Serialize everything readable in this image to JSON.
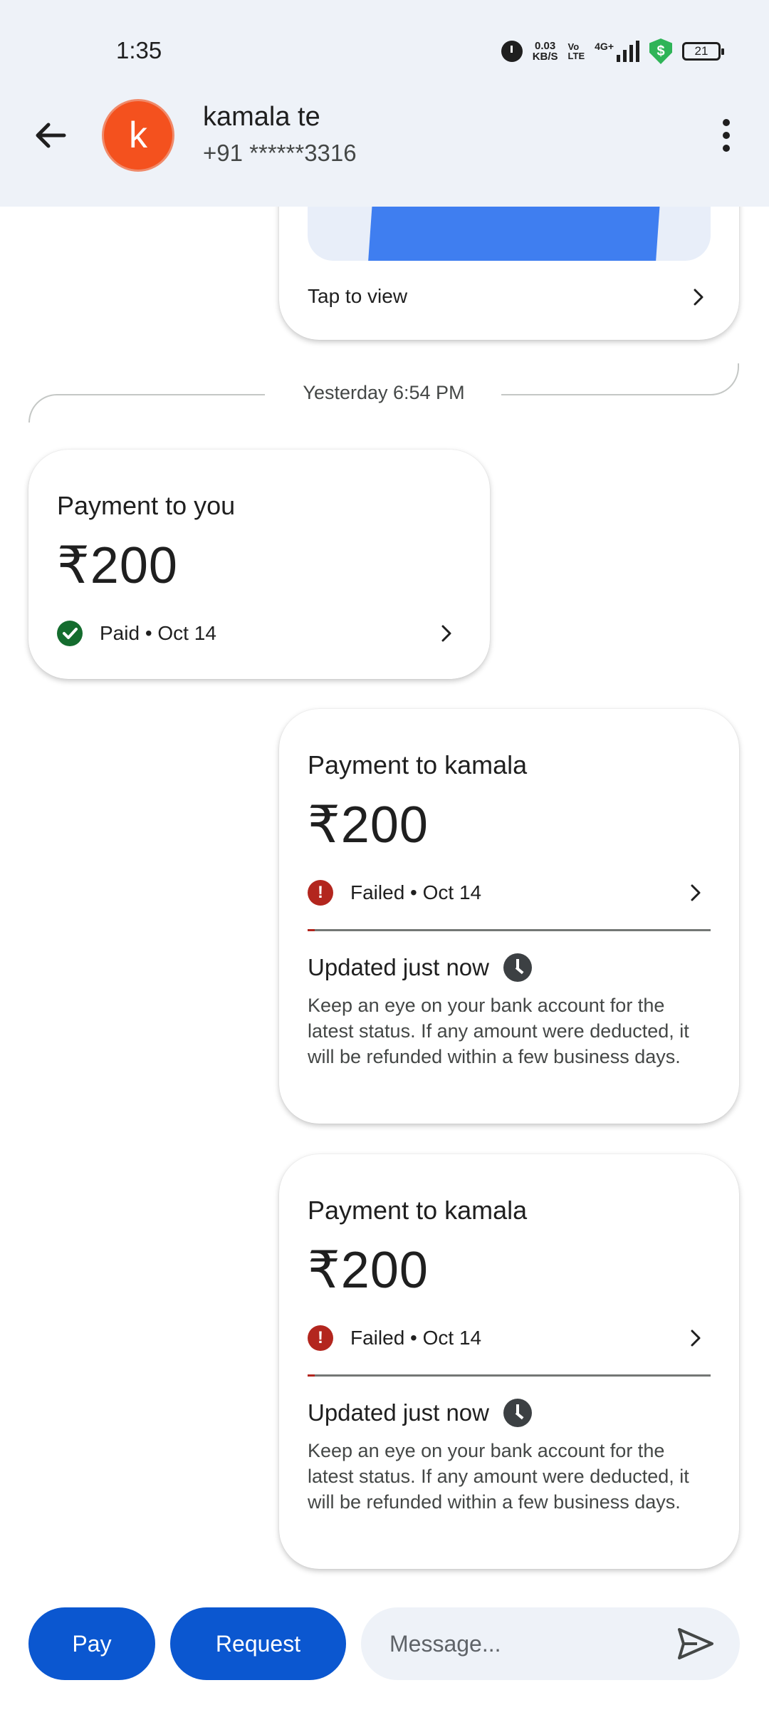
{
  "status_bar": {
    "time": "1:35",
    "net_speed_top": "0.03",
    "net_speed_bottom": "KB/S",
    "volte_top": "Vo",
    "volte_bottom": "LTE",
    "network": "4G+",
    "shield_glyph": "$",
    "battery": "21"
  },
  "header": {
    "avatar_letter": "k",
    "name": "kamala te",
    "phone": "+91 ******3316",
    "avatar_color": "#f4511e"
  },
  "chat": {
    "top_card": {
      "tap_label": "Tap to view"
    },
    "date_separator": "Yesterday 6:54 PM",
    "payments": [
      {
        "title": "Payment to you",
        "amount": "₹200",
        "status": "Paid • Oct 14",
        "status_icon": "check-circle-icon",
        "status_color": "#146c2e"
      },
      {
        "title": "Payment to kamala",
        "amount": "₹200",
        "status": "Failed • Oct 14",
        "status_icon": "error-circle-icon",
        "status_color": "#b3261e",
        "update_title": "Updated just now",
        "update_body": "Keep an eye on your bank account for the latest status. If any amount were deducted, it will be refunded within a few business days."
      },
      {
        "title": "Payment to kamala",
        "amount": "₹200",
        "status": "Failed • Oct 14",
        "status_icon": "error-circle-icon",
        "status_color": "#b3261e",
        "update_title": "Updated just now",
        "update_body": "Keep an eye on your bank account for the latest status. If any amount were deducted, it will be refunded within a few business days."
      }
    ]
  },
  "bottom_bar": {
    "pay_label": "Pay",
    "request_label": "Request",
    "message_placeholder": "Message...",
    "accent": "#0b57d0"
  }
}
